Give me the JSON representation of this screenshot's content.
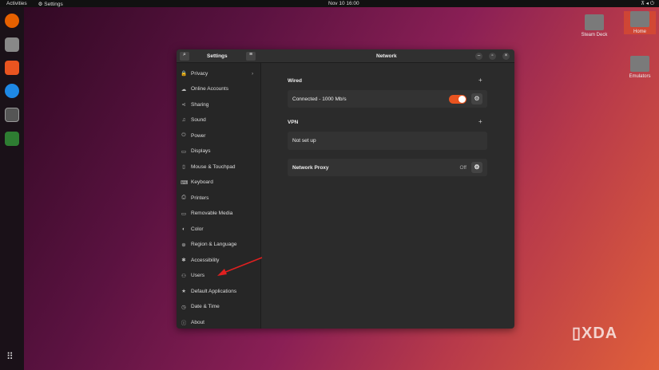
{
  "topbar": {
    "activities": "Activities",
    "app": "Settings",
    "clock": "Nov 10  16:00"
  },
  "desktop": {
    "icons": [
      "Steam Deck",
      "Home",
      "Emulators"
    ]
  },
  "window": {
    "sidebar_title": "Settings",
    "title": "Network",
    "sidebar": [
      {
        "icon": "lock-icon",
        "g": "🔒",
        "label": "Privacy"
      },
      {
        "icon": "cloud-icon",
        "g": "☁",
        "label": "Online Accounts"
      },
      {
        "icon": "share-icon",
        "g": "⋖",
        "label": "Sharing"
      },
      {
        "icon": "music-icon",
        "g": "♫",
        "label": "Sound"
      },
      {
        "icon": "power-icon",
        "g": "⏻",
        "label": "Power"
      },
      {
        "icon": "display-icon",
        "g": "▭",
        "label": "Displays"
      },
      {
        "icon": "mouse-icon",
        "g": "▯",
        "label": "Mouse & Touchpad"
      },
      {
        "icon": "keyboard-icon",
        "g": "⌨",
        "label": "Keyboard"
      },
      {
        "icon": "printer-icon",
        "g": "⎙",
        "label": "Printers"
      },
      {
        "icon": "drive-icon",
        "g": "▭",
        "label": "Removable Media"
      },
      {
        "icon": "color-icon",
        "g": "◐",
        "label": "Color"
      },
      {
        "icon": "globe-icon",
        "g": "⊕",
        "label": "Region & Language"
      },
      {
        "icon": "accessibility-icon",
        "g": "✱",
        "label": "Accessibility"
      },
      {
        "icon": "users-icon",
        "g": "⚇",
        "label": "Users"
      },
      {
        "icon": "star-icon",
        "g": "★",
        "label": "Default Applications"
      },
      {
        "icon": "clock-icon",
        "g": "◷",
        "label": "Date & Time"
      },
      {
        "icon": "info-icon",
        "g": "ⓘ",
        "label": "About"
      }
    ],
    "wired": {
      "heading": "Wired",
      "status": "Connected - 1000 Mb/s",
      "enabled": true
    },
    "vpn": {
      "heading": "VPN",
      "status": "Not set up"
    },
    "proxy": {
      "label": "Network Proxy",
      "state": "Off"
    }
  },
  "watermark": "XDA",
  "colors": {
    "accent": "#e95420"
  }
}
